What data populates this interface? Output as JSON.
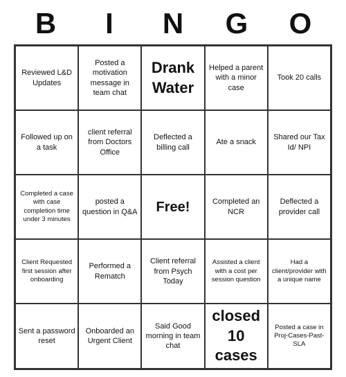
{
  "title": {
    "letters": [
      "B",
      "I",
      "N",
      "G",
      "O"
    ]
  },
  "cells": [
    {
      "id": "r0c0",
      "text": "Reviewed L&D Updates",
      "style": "normal"
    },
    {
      "id": "r0c1",
      "text": "Posted a motivation message in team chat",
      "style": "normal"
    },
    {
      "id": "r0c2",
      "text": "Drank Water",
      "style": "large"
    },
    {
      "id": "r0c3",
      "text": "Helped a parent with a minor case",
      "style": "normal"
    },
    {
      "id": "r0c4",
      "text": "Took 20 calls",
      "style": "normal"
    },
    {
      "id": "r1c0",
      "text": "Followed up on a task",
      "style": "normal"
    },
    {
      "id": "r1c1",
      "text": "client referral from Doctors Office",
      "style": "normal"
    },
    {
      "id": "r1c2",
      "text": "Deflected a billing call",
      "style": "normal"
    },
    {
      "id": "r1c3",
      "text": "Ate a snack",
      "style": "normal"
    },
    {
      "id": "r1c4",
      "text": "Shared our Tax Id/ NPI",
      "style": "normal"
    },
    {
      "id": "r2c0",
      "text": "Completed a case with case completion time under 3 minutes",
      "style": "small"
    },
    {
      "id": "r2c1",
      "text": "posted a question in Q&A",
      "style": "normal"
    },
    {
      "id": "r2c2",
      "text": "Free!",
      "style": "free"
    },
    {
      "id": "r2c3",
      "text": "Completed an NCR",
      "style": "normal"
    },
    {
      "id": "r2c4",
      "text": "Deflected a provider call",
      "style": "normal"
    },
    {
      "id": "r3c0",
      "text": "Client Requested first session after onboarding",
      "style": "small"
    },
    {
      "id": "r3c1",
      "text": "Performed a Rematch",
      "style": "normal"
    },
    {
      "id": "r3c2",
      "text": "Client referral from Psych Today",
      "style": "normal"
    },
    {
      "id": "r3c3",
      "text": "Assisted a client with a cost per session question",
      "style": "small"
    },
    {
      "id": "r3c4",
      "text": "Had a client/provider with a unique name",
      "style": "small"
    },
    {
      "id": "r4c0",
      "text": "Sent a password reset",
      "style": "normal"
    },
    {
      "id": "r4c1",
      "text": "Onboarded an Urgent Client",
      "style": "normal"
    },
    {
      "id": "r4c2",
      "text": "Said Good morning in team chat",
      "style": "normal"
    },
    {
      "id": "r4c3",
      "text": "closed 10 cases",
      "style": "large"
    },
    {
      "id": "r4c4",
      "text": "Posted a case in Proj-Cases-Past-SLA",
      "style": "small"
    }
  ]
}
